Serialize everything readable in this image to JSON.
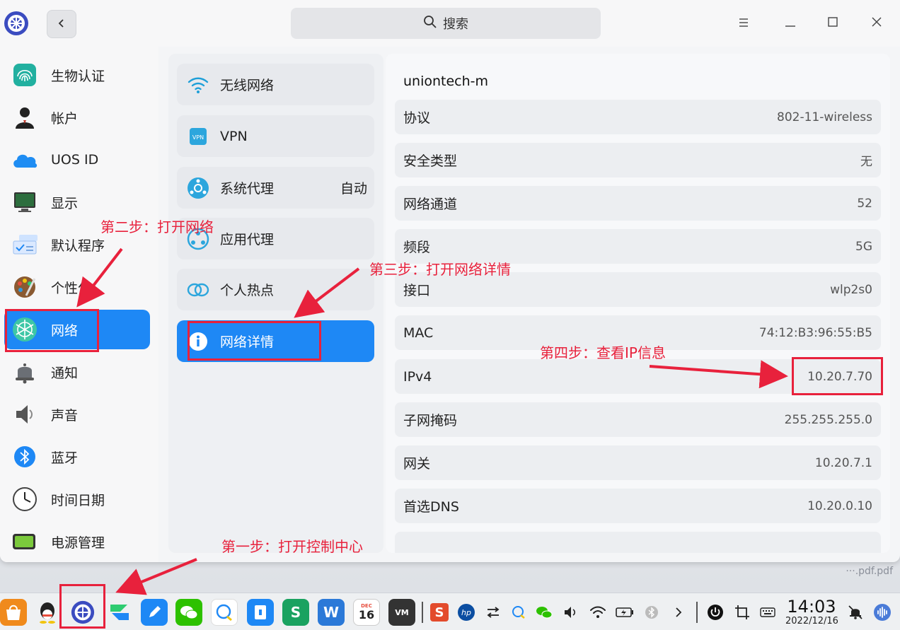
{
  "search": {
    "label": "搜索"
  },
  "sidebar": {
    "items": [
      {
        "label": "生物认证",
        "icon": "fingerprint-icon"
      },
      {
        "label": "帐户",
        "icon": "account-icon"
      },
      {
        "label": "UOS ID",
        "icon": "cloud-icon"
      },
      {
        "label": "显示",
        "icon": "monitor-icon"
      },
      {
        "label": "默认程序",
        "icon": "default-apps-icon"
      },
      {
        "label": "个性化",
        "icon": "palette-icon"
      },
      {
        "label": "网络",
        "icon": "network-icon",
        "active": true
      },
      {
        "label": "通知",
        "icon": "bell-icon"
      },
      {
        "label": "声音",
        "icon": "speaker-icon"
      },
      {
        "label": "蓝牙",
        "icon": "bluetooth-icon"
      },
      {
        "label": "时间日期",
        "icon": "clock-icon"
      },
      {
        "label": "电源管理",
        "icon": "battery-icon"
      }
    ]
  },
  "network_menu": {
    "items": [
      {
        "label": "无线网络",
        "value": "",
        "icon": "wifi-icon"
      },
      {
        "label": "VPN",
        "value": "",
        "icon": "vpn-icon"
      },
      {
        "label": "系统代理",
        "value": "自动",
        "icon": "system-proxy-icon"
      },
      {
        "label": "应用代理",
        "value": "",
        "icon": "app-proxy-icon"
      },
      {
        "label": "个人热点",
        "value": "",
        "icon": "hotspot-icon"
      },
      {
        "label": "网络详情",
        "value": "",
        "icon": "info-icon",
        "active": true
      }
    ]
  },
  "details": {
    "network_name": "uniontech-m",
    "rows": [
      {
        "key": "协议",
        "value": "802-11-wireless"
      },
      {
        "key": "安全类型",
        "value": "无"
      },
      {
        "key": "网络通道",
        "value": "52"
      },
      {
        "key": "频段",
        "value": "5G"
      },
      {
        "key": "接口",
        "value": "wlp2s0"
      },
      {
        "key": "MAC",
        "value": "74:12:B3:96:55:B5"
      },
      {
        "key": "IPv4",
        "value": "10.20.7.70"
      },
      {
        "key": "子网掩码",
        "value": "255.255.255.0"
      },
      {
        "key": "网关",
        "value": "10.20.7.1"
      },
      {
        "key": "首选DNS",
        "value": "10.20.0.10"
      }
    ]
  },
  "annotations": {
    "step1": "第一步：打开控制中心",
    "step2": "第二步：打开网络",
    "step3": "第三步：打开网络详情",
    "step4": "第四步：查看IP信息",
    "color": "#e8213c"
  },
  "taskbar": {
    "clock_time": "14:03",
    "clock_date": "2022/12/16",
    "calendar_day": "16",
    "calendar_month": "DEC",
    "wps_letter": "S",
    "writer_letter": "W",
    "vm_label": "VM"
  },
  "desktop": {
    "file_label": "···.pdf.pdf"
  },
  "colors": {
    "accent": "#1e88f5"
  }
}
